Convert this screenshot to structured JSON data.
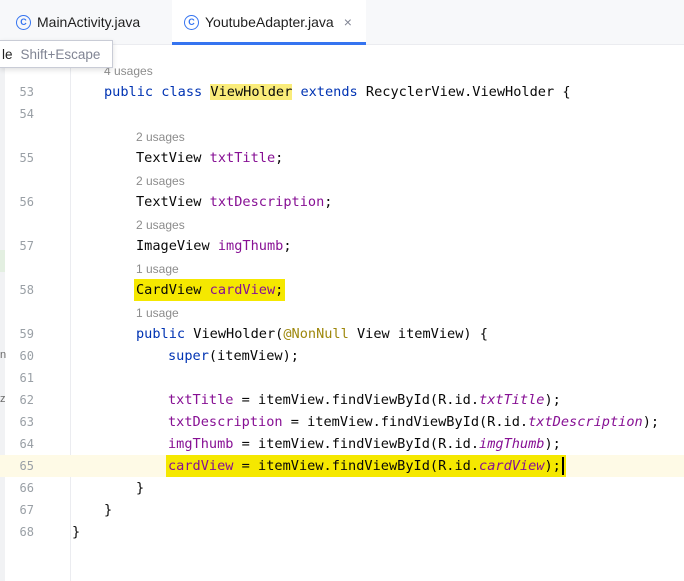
{
  "tabs": [
    {
      "label": "MainActivity.java",
      "icon": "class-c-icon",
      "active": false
    },
    {
      "label": "YoutubeAdapter.java",
      "icon": "class-c-icon",
      "active": true,
      "close": "×"
    }
  ],
  "tooltip": {
    "prefix": "le",
    "shortcut": "Shift+Escape"
  },
  "gutter_edge_chars": {
    "n": "n",
    "z": "z"
  },
  "hints": {
    "h52": "4 usages",
    "h55": "2 usages",
    "h56": "2 usages",
    "h57": "2 usages",
    "h58": "1 usage",
    "h59": "1 usage"
  },
  "lines": {
    "n53": "53",
    "n54": "54",
    "n55": "55",
    "n56": "56",
    "n57": "57",
    "n58": "58",
    "n59": "59",
    "n60": "60",
    "n61": "61",
    "n62": "62",
    "n63": "63",
    "n64": "64",
    "n65": "65",
    "n66": "66",
    "n67": "67",
    "n68": "68"
  },
  "code": {
    "l53_public": "public",
    "l53_class": "class",
    "l53_vh": "ViewHolder",
    "l53_extends": "extends",
    "l53_rest": " RecyclerView.ViewHolder {",
    "l55_type": "TextView ",
    "l55_name": "txtTitle",
    "l55_end": ";",
    "l56_type": "TextView ",
    "l56_name": "txtDescription",
    "l56_end": ";",
    "l57_type": "ImageView ",
    "l57_name": "imgThumb",
    "l57_end": ";",
    "l58_type": "CardView ",
    "l58_name": "cardView",
    "l58_end": ";",
    "l59_public": "public",
    "l59_ctor": " ViewHolder(",
    "l59_ann": "@NonNull",
    "l59_rest": " View itemView) {",
    "l60_super": "super",
    "l60_rest": "(itemView);",
    "l62_name": "txtTitle",
    "l62_mid": " = itemView.findViewById(R.id.",
    "l62_id": "txtTitle",
    "l62_end": ");",
    "l63_name": "txtDescription",
    "l63_mid": " = itemView.findViewById(R.id.",
    "l63_id": "txtDescription",
    "l63_end": ");",
    "l64_name": "imgThumb",
    "l64_mid": " = itemView.findViewById(R.id.",
    "l64_id": "imgThumb",
    "l64_end": ");",
    "l65_name": "cardView",
    "l65_mid": " = itemView.findViewById(R.id.",
    "l65_id": "cardView",
    "l65_end": ");",
    "l66": "}",
    "l67": "}",
    "l68": "}"
  }
}
